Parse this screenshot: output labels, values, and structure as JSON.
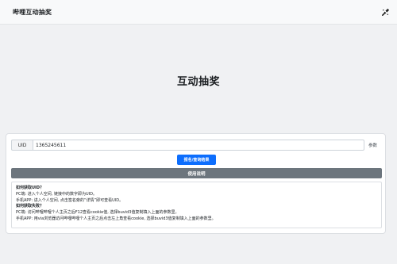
{
  "navbar": {
    "brand": "哔哩互动抽奖",
    "icon": "paint-brush-icon"
  },
  "hero": {
    "title": "互动抽奖"
  },
  "form": {
    "uid_label": "UID",
    "uid_value": "1365245611",
    "params_link": "参数",
    "submit_label": "报名/查询结果",
    "usage_label": "使用说明"
  },
  "help": {
    "heading_uid": "如何获取UID？",
    "pc_uid": "PC端: 进入个人空间, 链接中的数字即为UID。",
    "app_uid": "手机APP: 进入个人空间, 点击签名旁的“详情”即可查看UID。",
    "heading_cookie": "如何获取失败？",
    "pc_cookie": "PC端: 访问哔哩哔哩个人主页之后F12查看cookie值, 选择buvid3值复制填入上面的参数里。",
    "app_cookie": "手机APP: 用via浏览器访问哔哩哔哩个人主页之后点击左上角查看cookie, 选择buvid3值复制填入上面的参数里。"
  },
  "colors": {
    "primary": "#0d6efd",
    "secondary": "#6c757d",
    "navbar_bg": "#f8f9fa",
    "page_bg": "#f0f1f3"
  }
}
